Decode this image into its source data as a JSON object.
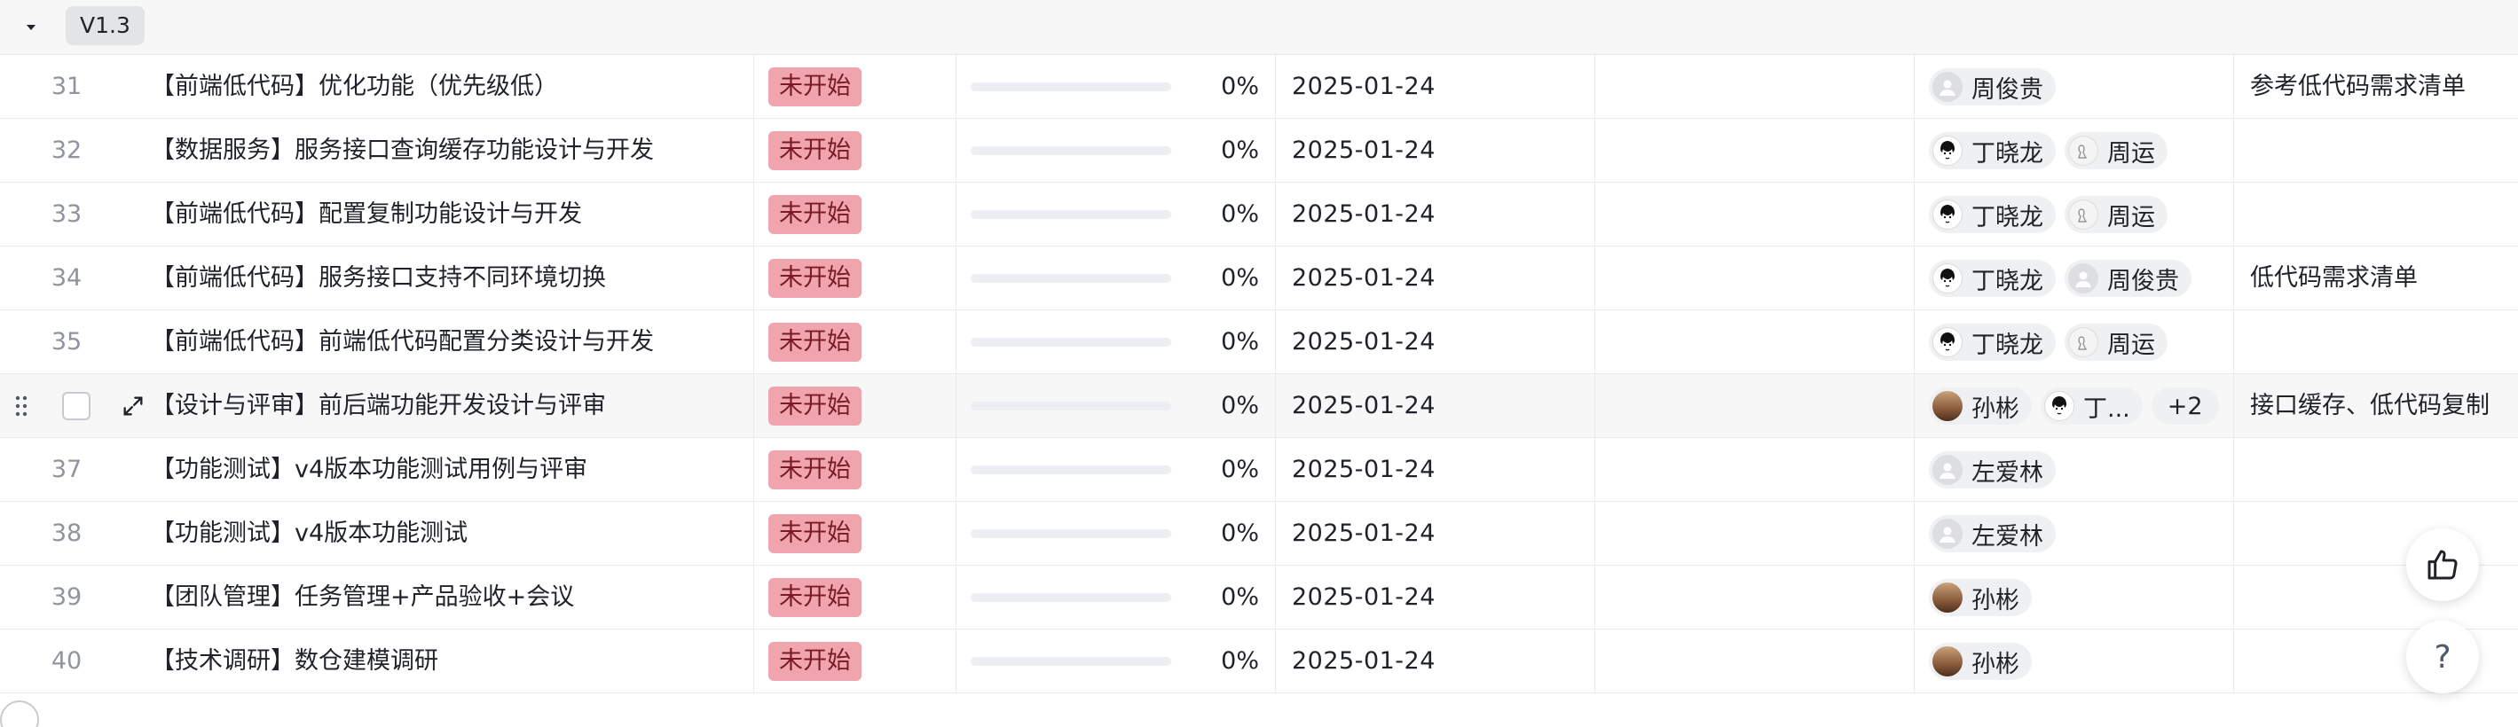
{
  "group": {
    "label": "V1.3"
  },
  "rows": [
    {
      "num": "31",
      "title": "【前端低代码】优化功能（优先级低）",
      "status": "未开始",
      "progress_pct": 0,
      "progress": "0%",
      "date": "2025-01-24",
      "owners": [
        {
          "name": "周俊贵",
          "avatar": "gray"
        }
      ],
      "note": "参考低代码需求清单"
    },
    {
      "num": "32",
      "title": "【数据服务】服务接口查询缓存功能设计与开发",
      "status": "未开始",
      "progress_pct": 0,
      "progress": "0%",
      "date": "2025-01-24",
      "owners": [
        {
          "name": "丁晓龙",
          "avatar": "dark"
        },
        {
          "name": "周运",
          "avatar": "sketch"
        }
      ],
      "note": ""
    },
    {
      "num": "33",
      "title": "【前端低代码】配置复制功能设计与开发",
      "status": "未开始",
      "progress_pct": 0,
      "progress": "0%",
      "date": "2025-01-24",
      "owners": [
        {
          "name": "丁晓龙",
          "avatar": "dark"
        },
        {
          "name": "周运",
          "avatar": "sketch"
        }
      ],
      "note": ""
    },
    {
      "num": "34",
      "title": "【前端低代码】服务接口支持不同环境切换",
      "status": "未开始",
      "progress_pct": 0,
      "progress": "0%",
      "date": "2025-01-24",
      "owners": [
        {
          "name": "丁晓龙",
          "avatar": "dark"
        },
        {
          "name": "周俊贵",
          "avatar": "gray"
        }
      ],
      "note": "低代码需求清单"
    },
    {
      "num": "35",
      "title": "【前端低代码】前端低代码配置分类设计与开发",
      "status": "未开始",
      "progress_pct": 0,
      "progress": "0%",
      "date": "2025-01-24",
      "owners": [
        {
          "name": "丁晓龙",
          "avatar": "dark"
        },
        {
          "name": "周运",
          "avatar": "sketch"
        }
      ],
      "note": ""
    },
    {
      "num": "",
      "hover": true,
      "title": "【设计与评审】前后端功能开发设计与评审",
      "status": "未开始",
      "progress_pct": 0,
      "progress": "0%",
      "date": "2025-01-24",
      "owners": [
        {
          "name": "孙彬",
          "avatar": "photo"
        },
        {
          "name": "丁...",
          "avatar": "dark"
        }
      ],
      "more": "+2",
      "note": "接口缓存、低代码复制"
    },
    {
      "num": "37",
      "title": "【功能测试】v4版本功能测试用例与评审",
      "status": "未开始",
      "progress_pct": 0,
      "progress": "0%",
      "date": "2025-01-24",
      "owners": [
        {
          "name": "左爱林",
          "avatar": "gray"
        }
      ],
      "note": ""
    },
    {
      "num": "38",
      "title": "【功能测试】v4版本功能测试",
      "status": "未开始",
      "progress_pct": 0,
      "progress": "0%",
      "date": "2025-01-24",
      "owners": [
        {
          "name": "左爱林",
          "avatar": "gray"
        }
      ],
      "note": ""
    },
    {
      "num": "39",
      "title": "【团队管理】任务管理+产品验收+会议",
      "status": "未开始",
      "progress_pct": 0,
      "progress": "0%",
      "date": "2025-01-24",
      "owners": [
        {
          "name": "孙彬",
          "avatar": "photo"
        }
      ],
      "note": ""
    },
    {
      "num": "40",
      "title": "【技术调研】数仓建模调研",
      "status": "未开始",
      "progress_pct": 0,
      "progress": "0%",
      "date": "2025-01-24",
      "owners": [
        {
          "name": "孙彬",
          "avatar": "photo"
        }
      ],
      "note": ""
    }
  ],
  "floating": {
    "help_label": "?"
  },
  "colors": {
    "status_bg": "#f0a5ae",
    "status_text": "#7a1a26",
    "progress_fill": "#3370ff"
  }
}
